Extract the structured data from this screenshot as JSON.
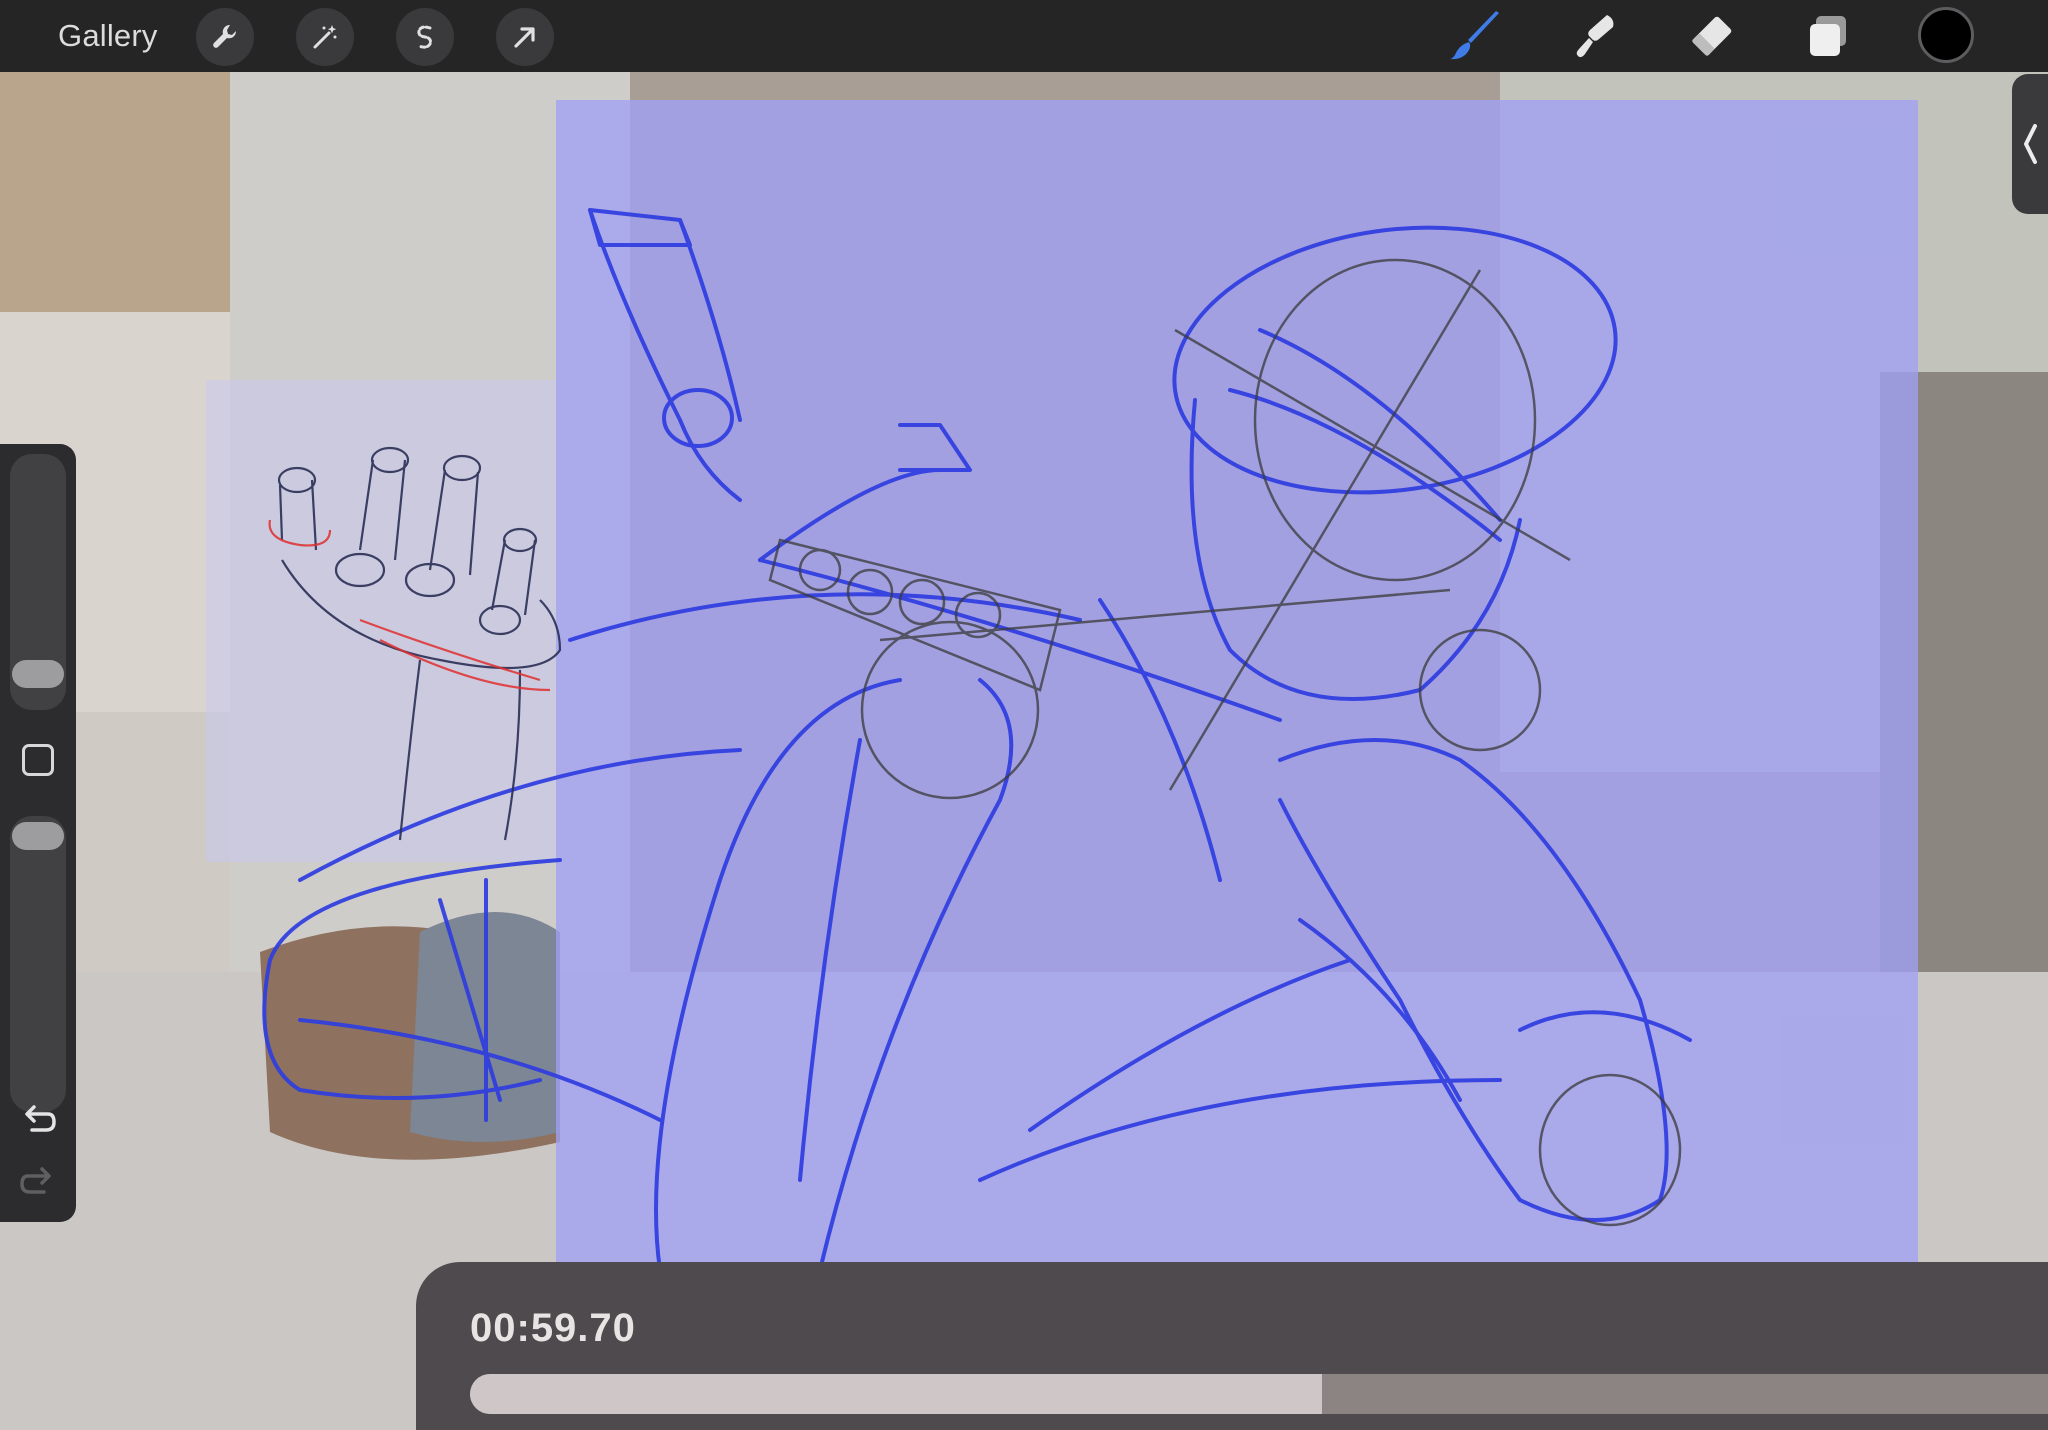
{
  "app": {
    "gallery_label": "Gallery",
    "current_color": "#000000",
    "sketch_colors": {
      "main": "#2f3de0",
      "construction": "#3a3a3a",
      "accent": "#e03030"
    }
  },
  "toolbar": {
    "left_tools": [
      "wrench-icon",
      "magic-wand-icon",
      "selection-s-icon",
      "transform-arrow-icon"
    ],
    "right_tools": [
      "brush-icon",
      "smudge-icon",
      "eraser-icon",
      "layers-icon"
    ]
  },
  "sidebar": {
    "controls": [
      "brush-size-slider",
      "modify-button",
      "opacity-slider",
      "undo-icon",
      "redo-icon"
    ]
  },
  "video": {
    "timecode": "00:59.70",
    "progress": 0.54
  }
}
